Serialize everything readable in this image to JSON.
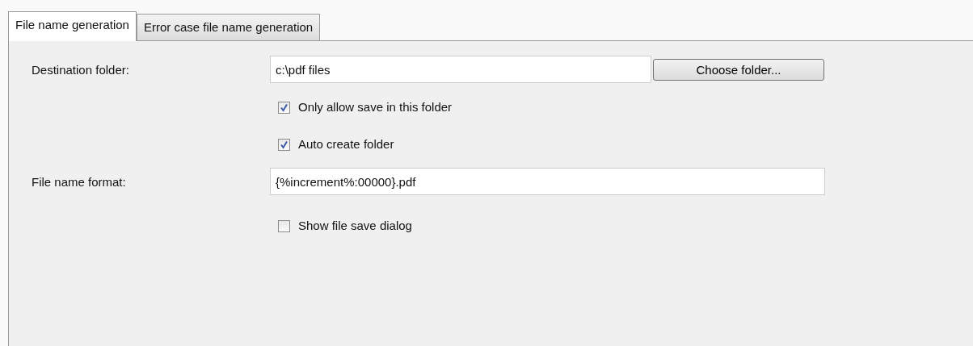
{
  "tabs": [
    {
      "label": "File name generation",
      "selected": true
    },
    {
      "label": "Error case file name generation",
      "selected": false
    }
  ],
  "destination_folder": {
    "label": "Destination folder:",
    "value": "c:\\pdf files",
    "button": "Choose folder..."
  },
  "folder_options": [
    {
      "label": "Only allow save in this folder",
      "checked": true
    },
    {
      "label": "Auto create folder",
      "checked": true
    }
  ],
  "file_name_format": {
    "label": "File name format:",
    "value": "{%increment%:00000}.pdf"
  },
  "save_options": [
    {
      "label": "Show file save dialog",
      "checked": false
    }
  ]
}
